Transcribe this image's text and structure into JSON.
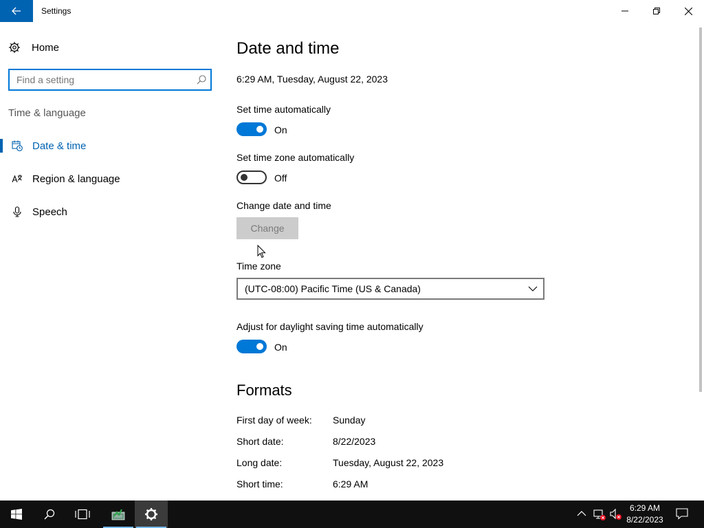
{
  "window": {
    "title": "Settings"
  },
  "sidebar": {
    "home_label": "Home",
    "search_placeholder": "Find a setting",
    "section_title": "Time & language",
    "items": [
      {
        "label": "Date & time",
        "icon": "calendar-clock-icon",
        "active": true
      },
      {
        "label": "Region & language",
        "icon": "language-icon",
        "active": false
      },
      {
        "label": "Speech",
        "icon": "microphone-icon",
        "active": false
      }
    ]
  },
  "main": {
    "title": "Date and time",
    "current_time": "6:29 AM, Tuesday, August 22, 2023",
    "set_time_auto": {
      "label": "Set time automatically",
      "state": "On"
    },
    "set_tz_auto": {
      "label": "Set time zone automatically",
      "state": "Off"
    },
    "change_date": {
      "label": "Change date and time",
      "button": "Change"
    },
    "time_zone": {
      "label": "Time zone",
      "value": "(UTC-08:00) Pacific Time (US & Canada)"
    },
    "dst": {
      "label": "Adjust for daylight saving time automatically",
      "state": "On"
    },
    "formats": {
      "title": "Formats",
      "rows": [
        {
          "key": "First day of week:",
          "value": "Sunday"
        },
        {
          "key": "Short date:",
          "value": "8/22/2023"
        },
        {
          "key": "Long date:",
          "value": "Tuesday, August 22, 2023"
        },
        {
          "key": "Short time:",
          "value": "6:29 AM"
        }
      ]
    }
  },
  "taskbar": {
    "time": "6:29 AM",
    "date": "8/22/2023"
  },
  "colors": {
    "accent": "#0078d7",
    "accent_dark": "#0063b1",
    "taskbar": "#101010"
  }
}
